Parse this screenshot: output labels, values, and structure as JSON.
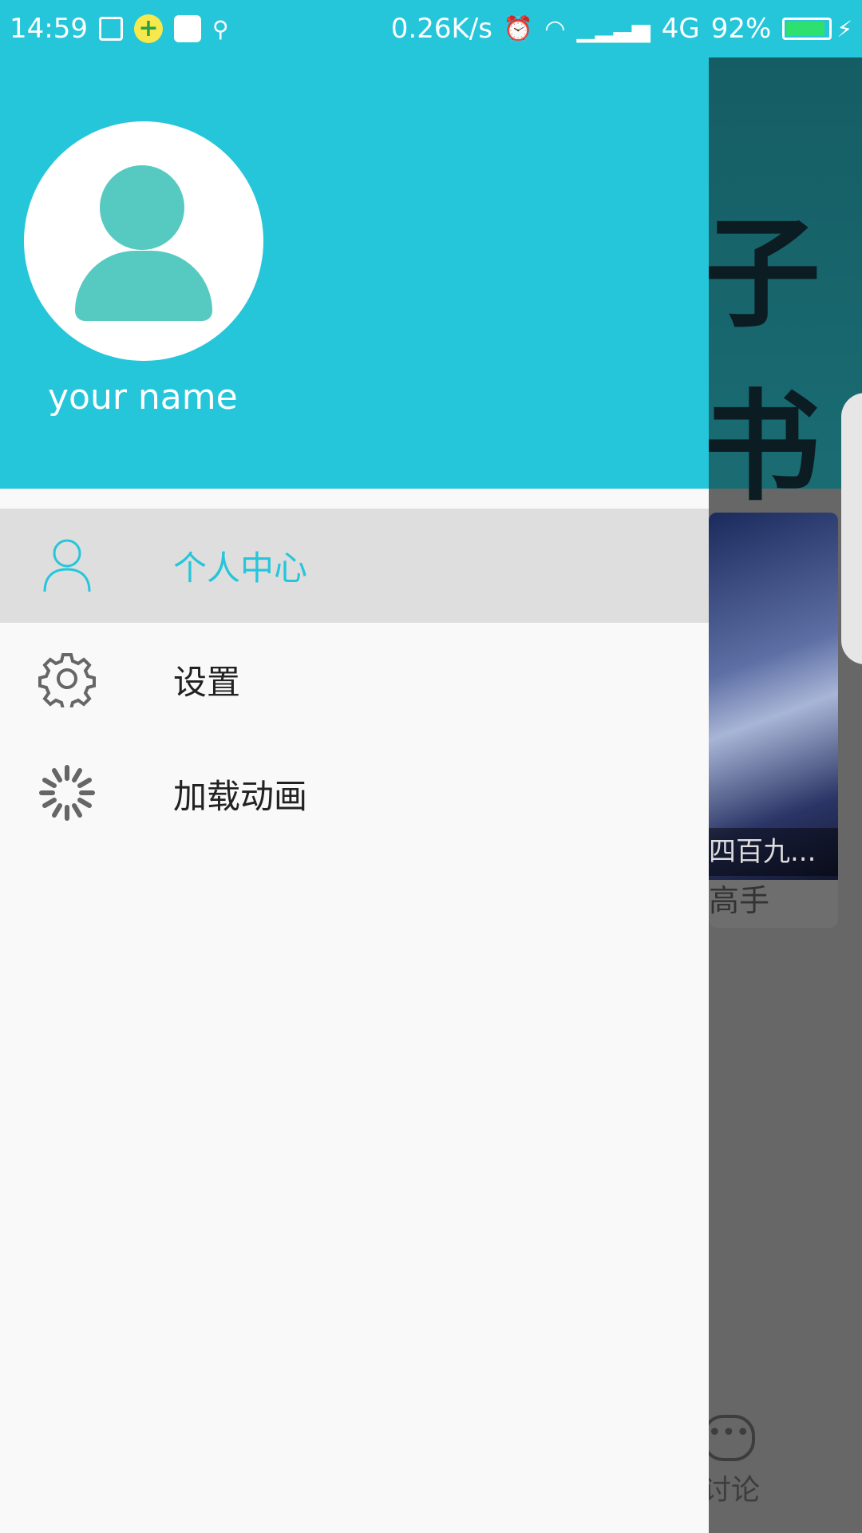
{
  "status_bar": {
    "time": "14:59",
    "speed": "0.26K/s",
    "network": "4G",
    "battery_percent": "92%",
    "battery_level": 0.92,
    "icons": [
      "screenshot-icon",
      "plus-app-icon",
      "app-icon",
      "usb-icon",
      "alarm-icon",
      "wifi-icon",
      "signal-icon",
      "battery-icon",
      "charging-icon"
    ]
  },
  "drawer": {
    "header_color": "#26c6da",
    "user_name": "your name",
    "menu": [
      {
        "label": "个人中心",
        "icon": "person-icon",
        "active": true
      },
      {
        "label": "设置",
        "icon": "gear-icon",
        "active": false
      },
      {
        "label": "加载动画",
        "icon": "loading-spinner-icon",
        "active": false
      }
    ]
  },
  "background": {
    "banner_text": "子书",
    "card_caption": "四百九...",
    "card_title": "高手",
    "tab_label": "讨论"
  }
}
